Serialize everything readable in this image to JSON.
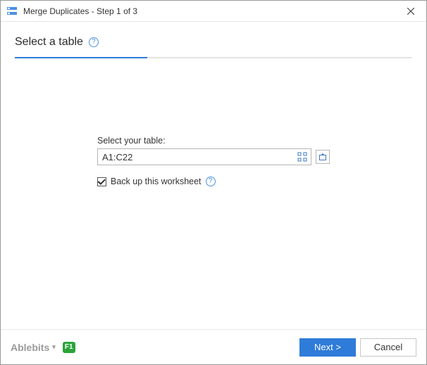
{
  "titlebar": {
    "title": "Merge Duplicates - Step 1 of 3"
  },
  "step": {
    "heading": "Select a table",
    "progress_fraction": "33.33%"
  },
  "form": {
    "table_label": "Select your table:",
    "table_value": "A1:C22",
    "backup_label": "Back up this worksheet",
    "backup_checked": true
  },
  "footer": {
    "brand": "Ablebits",
    "help_badge": "F1",
    "next_label": "Next >",
    "cancel_label": "Cancel"
  },
  "colors": {
    "accent": "#2f7bd9"
  }
}
